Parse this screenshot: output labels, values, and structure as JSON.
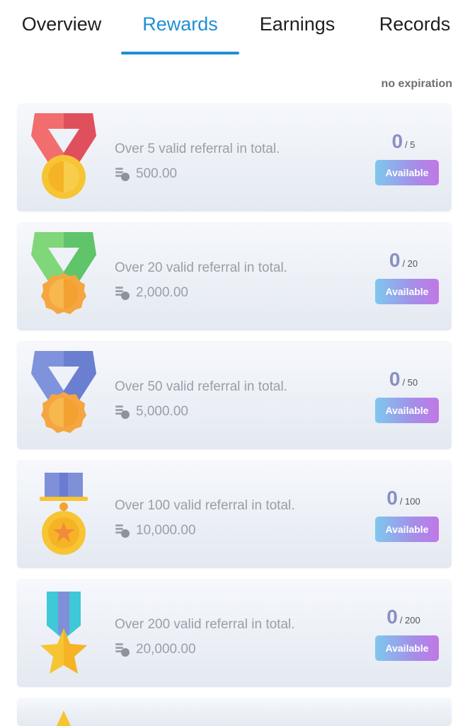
{
  "tabs": [
    {
      "label": "Overview"
    },
    {
      "label": "Rewards"
    },
    {
      "label": "Earnings"
    },
    {
      "label": "Records"
    }
  ],
  "active_tab": "Rewards",
  "expiration_note": "no expiration",
  "rewards": [
    {
      "description": "Over 5 valid referral in total.",
      "amount": "500.00",
      "count": "0",
      "total": "/ 5",
      "status": "Available",
      "medal": "red-ribbon-medal-icon"
    },
    {
      "description": "Over 20 valid referral in total.",
      "amount": "2,000.00",
      "count": "0",
      "total": "/ 20",
      "status": "Available",
      "medal": "green-ribbon-medal-icon"
    },
    {
      "description": "Over 50 valid referral in total.",
      "amount": "5,000.00",
      "count": "0",
      "total": "/ 50",
      "status": "Available",
      "medal": "blue-ribbon-medal-icon"
    },
    {
      "description": "Over 100 valid referral in total.",
      "amount": "10,000.00",
      "count": "0",
      "total": "/ 100",
      "status": "Available",
      "medal": "star-medal-icon"
    },
    {
      "description": "Over 200 valid referral in total.",
      "amount": "20,000.00",
      "count": "0",
      "total": "/ 200",
      "status": "Available",
      "medal": "star-ribbon-medal-icon"
    }
  ],
  "colors": {
    "accent": "#1f8fd6",
    "button_gradient_start": "#7ec8ee",
    "button_gradient_end": "#c277e6",
    "muted_text": "#9a9ea6",
    "count_text": "#8a8fc4"
  }
}
